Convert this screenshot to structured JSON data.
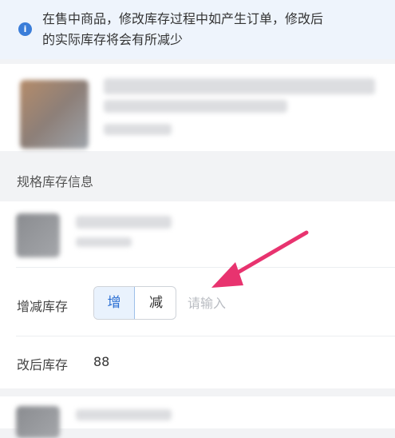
{
  "notice": {
    "icon": "info-icon",
    "line1": "在售中商品，修改库存过程中如产生订单，修改后",
    "line2": "的实际库存将会有所减少"
  },
  "spec_section": {
    "title": "规格库存信息"
  },
  "adjust_stock": {
    "label": "增减库存",
    "options": [
      "增",
      "减"
    ],
    "selected": "增",
    "input_placeholder": "请输入"
  },
  "after_stock": {
    "label": "改后库存",
    "value": "88"
  },
  "colors": {
    "accent": "#2b6fd3",
    "annotation_arrow": "#e8336f"
  }
}
